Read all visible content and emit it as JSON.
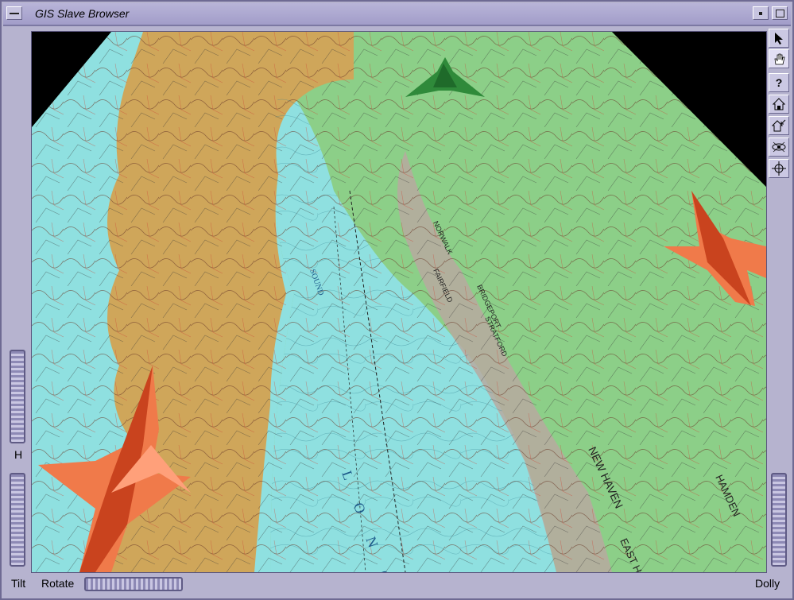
{
  "window": {
    "title": "GIS Slave Browser"
  },
  "viewer": {
    "map_labels": [
      "SOUND",
      "L  O  N  G",
      "NEW HAVEN",
      "EAST HAVEN",
      "HAMDEN",
      "STRATFORD",
      "BRIDGEPORT",
      "FAIRFIELD",
      "NORWALK"
    ],
    "colors": {
      "water": "#8fe0e0",
      "land_green": "#8ccf88",
      "land_tan": "#cfa65a",
      "background": "#000000"
    }
  },
  "toolbar": {
    "tools": [
      {
        "name": "pointer-icon",
        "label": ""
      },
      {
        "name": "hand-icon",
        "label": ""
      },
      {
        "name": "help-icon",
        "label": "?"
      },
      {
        "name": "home-icon",
        "label": ""
      },
      {
        "name": "set-home-icon",
        "label": ""
      },
      {
        "name": "view-all-icon",
        "label": ""
      },
      {
        "name": "seek-icon",
        "label": ""
      }
    ]
  },
  "controls": {
    "h_label": "H",
    "tilt_label": "Tilt",
    "rotate_label": "Rotate",
    "dolly_label": "Dolly"
  }
}
